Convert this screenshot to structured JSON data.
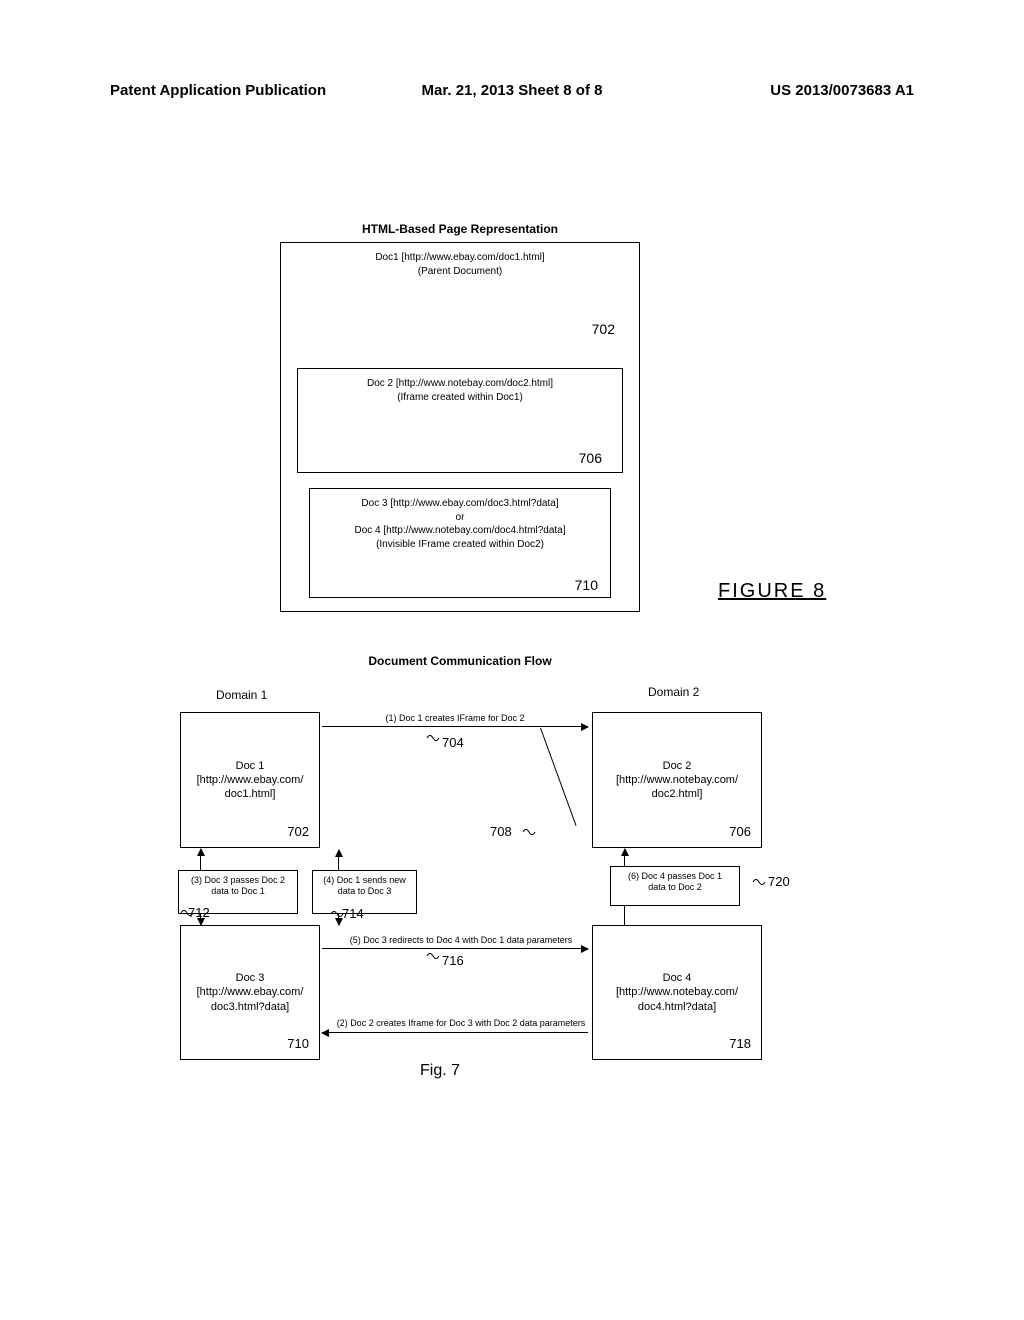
{
  "header": {
    "left": "Patent Application Publication",
    "mid": "Mar. 21, 2013  Sheet 8 of 8",
    "right": "US 2013/0073683 A1"
  },
  "top": {
    "title": "HTML-Based Page Representation",
    "doc1_l1": "Doc1 [http://www.ebay.com/doc1.html]",
    "doc1_l2": "(Parent Document)",
    "ref702": "702",
    "doc2_l1": "Doc 2 [http://www.notebay.com/doc2.html]",
    "doc2_l2": "(Iframe created within Doc1)",
    "ref706": "706",
    "doc3_l1": "Doc 3 [http://www.ebay.com/doc3.html?data]",
    "doc3_or": "or",
    "doc3_l2": "Doc 4 [http://www.notebay.com/doc4.html?data]",
    "doc3_l3": "(Invisible IFrame created within Doc2)",
    "ref710": "710",
    "fig8": "FIGURE 8"
  },
  "bot": {
    "title": "Document Communication Flow",
    "domain1": "Domain 1",
    "domain2": "Domain 2",
    "doc1_l1": "Doc 1",
    "doc1_l2": "[http://www.ebay.com/",
    "doc1_l3": "doc1.html]",
    "doc1_ref": "702",
    "doc2_l1": "Doc 2",
    "doc2_l2": "[http://www.notebay.com/",
    "doc2_l3": "doc2.html]",
    "doc2_ref": "706",
    "doc3_l1": "Doc 3",
    "doc3_l2": "[http://www.ebay.com/",
    "doc3_l3": "doc3.html?data]",
    "doc3_ref": "710",
    "doc4_l1": "Doc 4",
    "doc4_l2": "[http://www.notebay.com/",
    "doc4_l3": "doc4.html?data]",
    "doc4_ref": "718",
    "sb1_l1": "(3) Doc 3 passes Doc 2",
    "sb1_l2": "data to Doc 1",
    "sb2_l1": "(4) Doc 1 sends new",
    "sb2_l2": "data to Doc 3",
    "sb3_l1": "(6) Doc 4 passes Doc 1",
    "sb3_l2": "data to Doc 2",
    "ann1": "(1) Doc 1 creates IFrame for Doc 2",
    "ann5": "(5) Doc 3 redirects to Doc 4 with Doc 1 data parameters",
    "ann2": "(2) Doc 2 creates Iframe for Doc 3 with Doc 2 data parameters",
    "r704": "704",
    "r708": "708",
    "r712": "712",
    "r714": "714",
    "r716": "716",
    "r720": "720",
    "fig7": "Fig. 7"
  }
}
